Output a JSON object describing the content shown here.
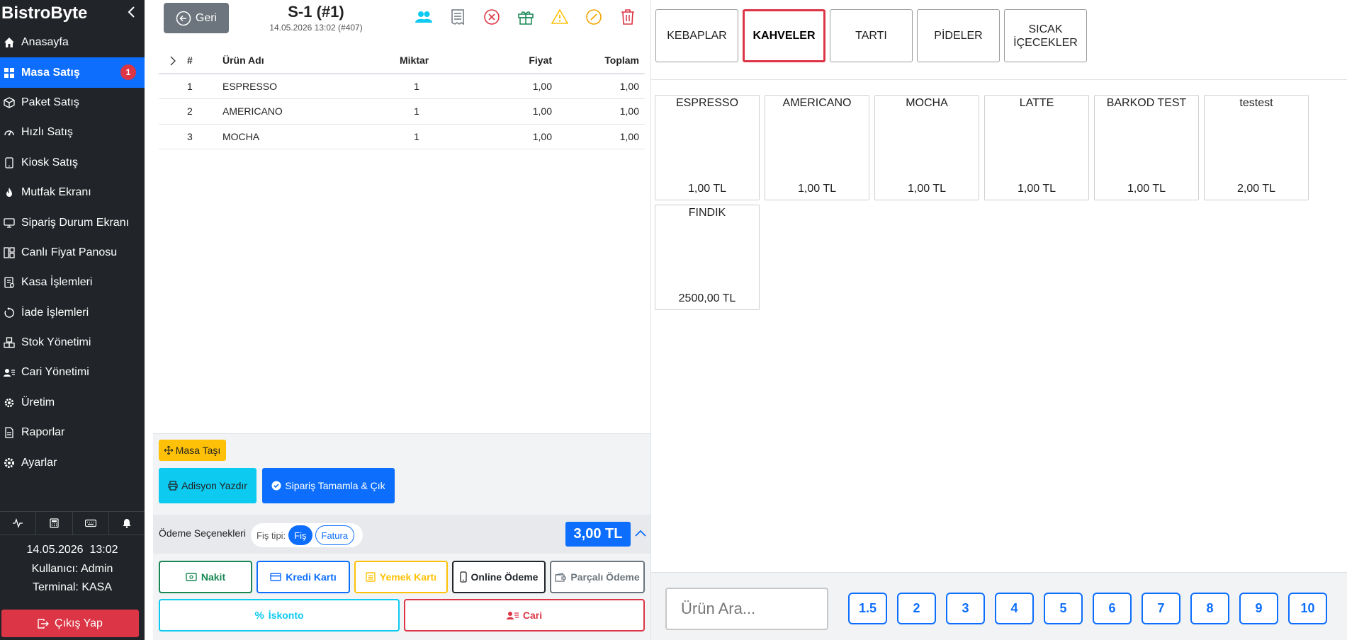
{
  "sidebar": {
    "brand": "BistroByte",
    "items": [
      {
        "label": "Anasayfa",
        "icon": "home-icon"
      },
      {
        "label": "Masa Satış",
        "icon": "grid-icon",
        "active": true,
        "badge": "1"
      },
      {
        "label": "Paket Satış",
        "icon": "box-icon"
      },
      {
        "label": "Hızlı Satış",
        "icon": "speedometer-icon"
      },
      {
        "label": "Kiosk Satış",
        "icon": "tablet-icon"
      },
      {
        "label": "Mutfak Ekranı",
        "icon": "fire-icon"
      },
      {
        "label": "Sipariş Durum Ekranı",
        "icon": "monitor-icon"
      },
      {
        "label": "Canlı Fiyat Panosu",
        "icon": "board-icon"
      },
      {
        "label": "Kasa İşlemleri",
        "icon": "cash-icon"
      },
      {
        "label": "İade İşlemleri",
        "icon": "refund-icon"
      },
      {
        "label": "Stok Yönetimi",
        "icon": "boxes-icon"
      },
      {
        "label": "Cari Yönetimi",
        "icon": "person-card-icon"
      },
      {
        "label": "Üretim",
        "icon": "cog-icon"
      },
      {
        "label": "Raporlar",
        "icon": "report-icon"
      },
      {
        "label": "Ayarlar",
        "icon": "settings-icon"
      }
    ],
    "info": {
      "datetime": "14.05.2026  13:02",
      "user": "Kullanıcı: Admin",
      "terminal": "Terminal: KASA"
    },
    "logout_label": "Çıkış Yap"
  },
  "order": {
    "back_label": "Geri",
    "title": "S-1 (#1)",
    "subtitle": "14.05.2026 13:02 (#407)",
    "columns": [
      "#",
      "Ürün Adı",
      "Miktar",
      "Fiyat",
      "Toplam"
    ],
    "rows": [
      {
        "no": "1",
        "name": "ESPRESSO",
        "qty": "1",
        "price": "1,00",
        "total": "1,00"
      },
      {
        "no": "2",
        "name": "AMERICANO",
        "qty": "1",
        "price": "1,00",
        "total": "1,00"
      },
      {
        "no": "3",
        "name": "MOCHA",
        "qty": "1",
        "price": "1,00",
        "total": "1,00"
      }
    ],
    "masa_tasi_label": "Masa Taşı",
    "adisyon_label": "Adisyon Yazdır",
    "tamamla_label": "Sipariş Tamamla & Çık",
    "payment": {
      "label": "Ödeme Seçenekleri",
      "fis_tipi_label": "Fiş tipi:",
      "fis_label": "Fiş",
      "fatura_label": "Fatura",
      "total": "3,00 TL",
      "methods": [
        {
          "label": "Nakit",
          "color": "#198754"
        },
        {
          "label": "Kredi Kartı",
          "color": "#0d6efd"
        },
        {
          "label": "Yemek Kartı",
          "color": "#ffc107"
        },
        {
          "label": "Online Ödeme",
          "color": "#212529"
        },
        {
          "label": "Parçalı Ödeme",
          "color": "#6c757d"
        }
      ],
      "iskonto_label": "İskonto",
      "cari_label": "Cari"
    }
  },
  "categories": [
    {
      "label": "KEBAPLAR"
    },
    {
      "label": "KAHVELER",
      "active": true
    },
    {
      "label": "TARTI"
    },
    {
      "label": "PİDELER"
    },
    {
      "label": "SICAK İÇECEKLER"
    }
  ],
  "products": [
    {
      "name": "ESPRESSO",
      "price": "1,00 TL"
    },
    {
      "name": "AMERICANO",
      "price": "1,00 TL"
    },
    {
      "name": "MOCHA",
      "price": "1,00 TL"
    },
    {
      "name": "LATTE",
      "price": "1,00 TL"
    },
    {
      "name": "BARKOD TEST",
      "price": "1,00 TL"
    },
    {
      "name": "testest",
      "price": "2,00 TL"
    },
    {
      "name": "FINDIK",
      "price": "2500,00 TL"
    }
  ],
  "search": {
    "placeholder": "Ürün Ara..."
  },
  "quantities": [
    "1.5",
    "2",
    "3",
    "4",
    "5",
    "6",
    "7",
    "8",
    "9",
    "10"
  ]
}
